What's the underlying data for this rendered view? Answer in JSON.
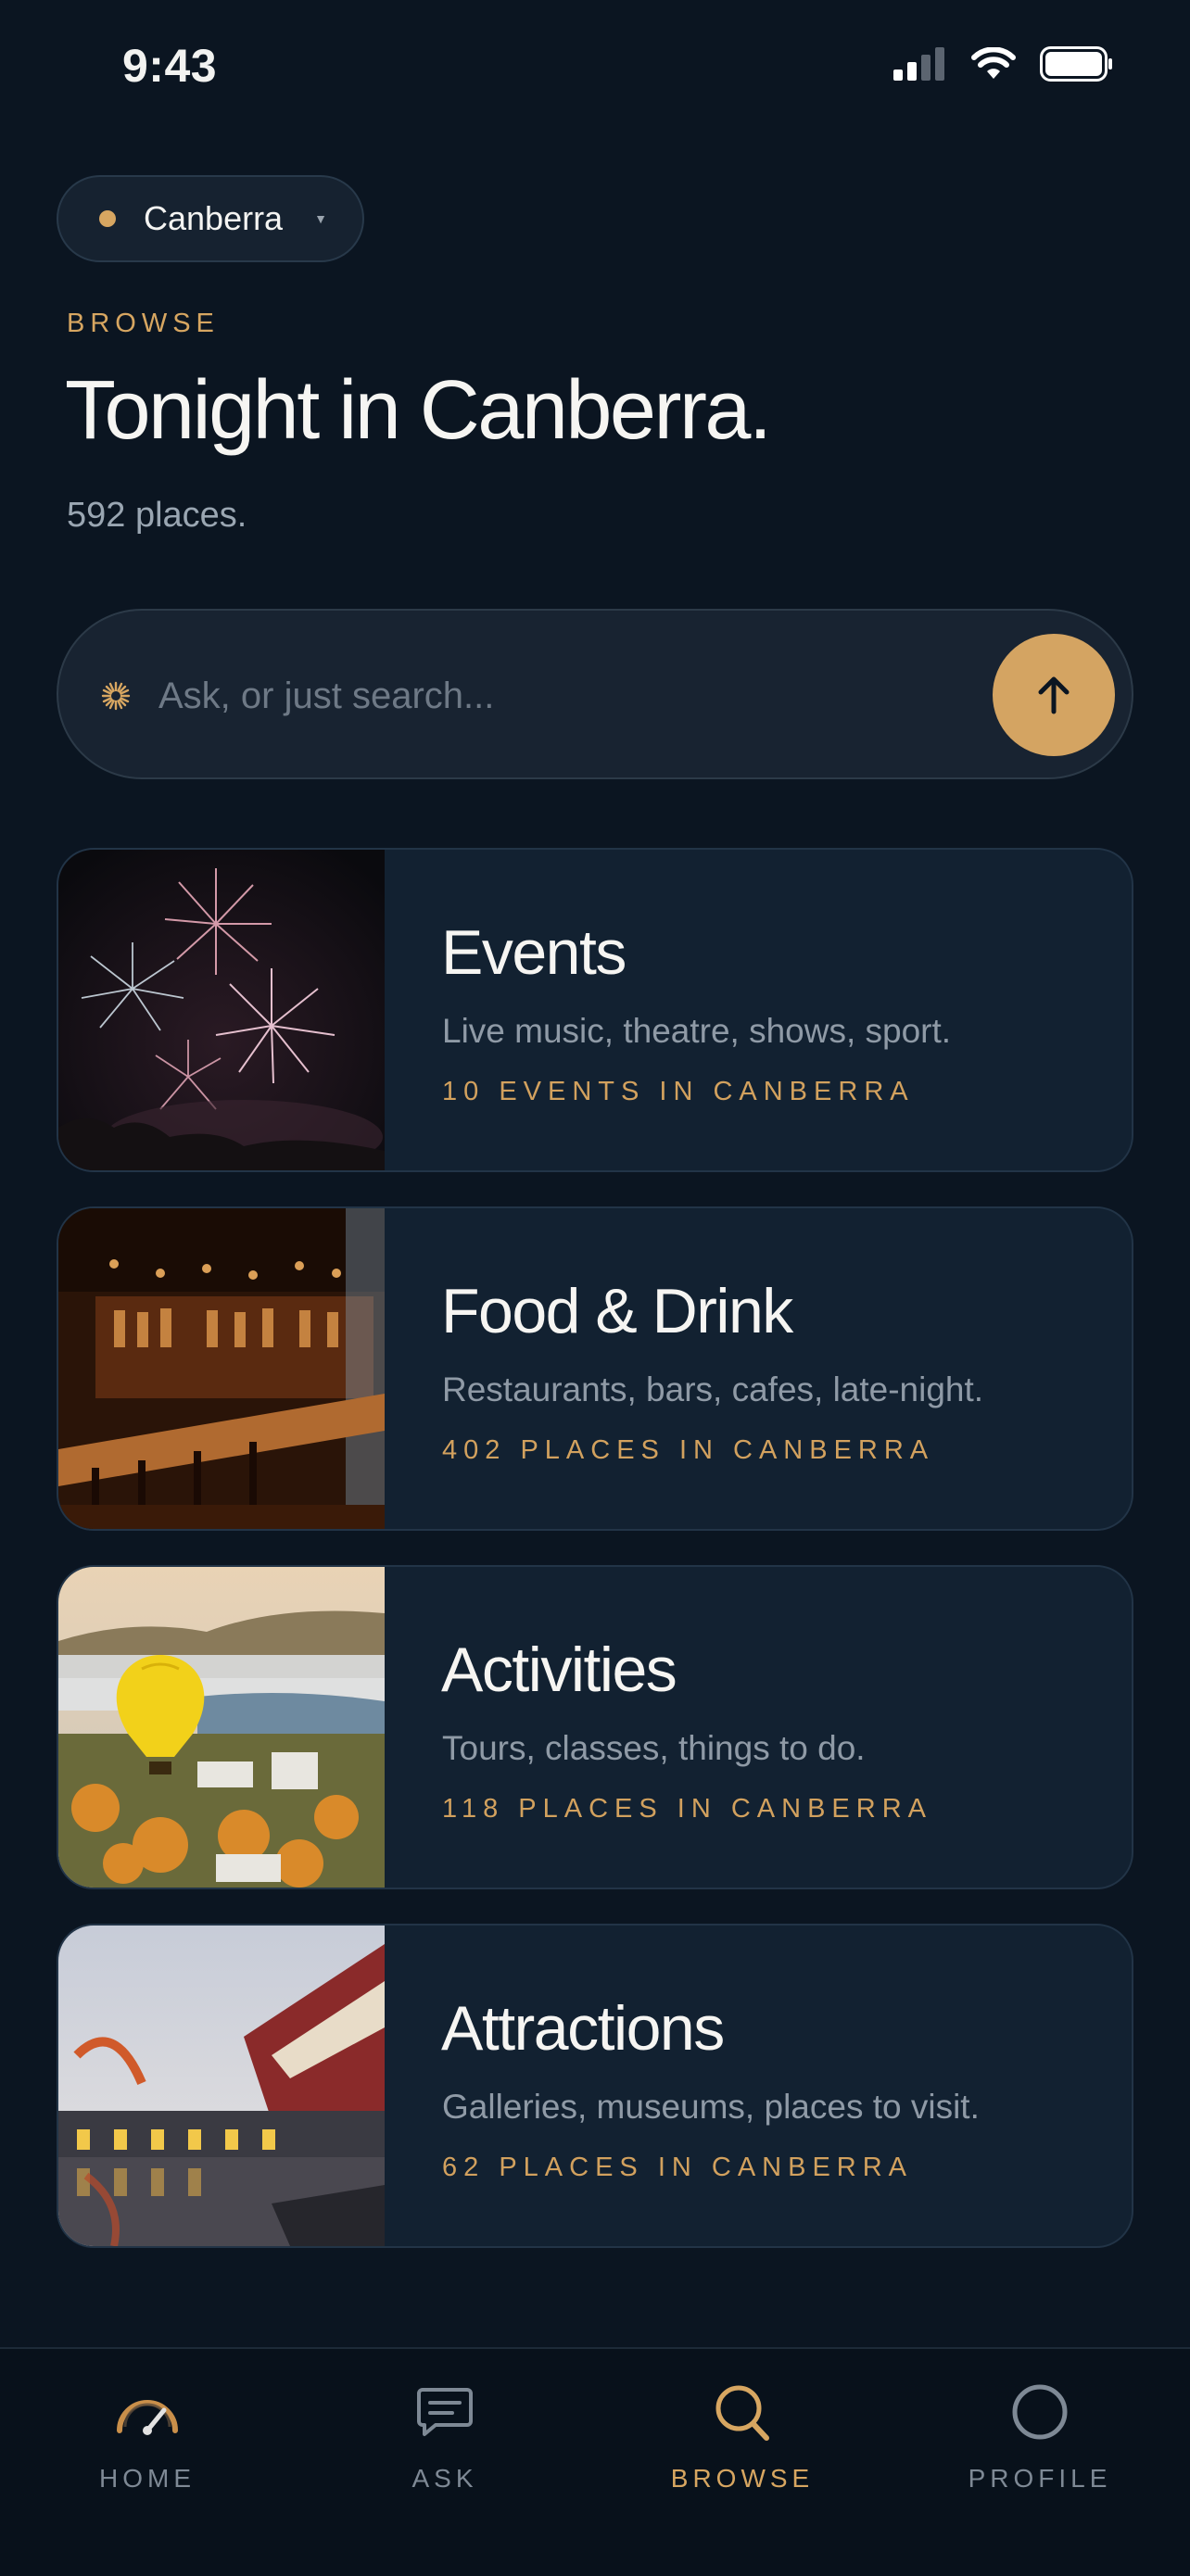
{
  "status_bar": {
    "time": "9:43"
  },
  "location": {
    "city": "Canberra"
  },
  "header": {
    "eyebrow": "BROWSE",
    "title": "Tonight in Canberra.",
    "count": "592 places."
  },
  "search": {
    "placeholder": "Ask, or just search..."
  },
  "categories": [
    {
      "title": "Events",
      "subtitle": "Live music, theatre, shows, sport.",
      "count": "10 EVENTS IN CANBERRA",
      "icon": "fireworks-photo"
    },
    {
      "title": "Food & Drink",
      "subtitle": "Restaurants, bars, cafes, late-night.",
      "count": "402 PLACES IN CANBERRA",
      "icon": "bar-interior-photo"
    },
    {
      "title": "Activities",
      "subtitle": "Tours, classes, things to do.",
      "count": "118 PLACES IN CANBERRA",
      "icon": "hot-air-balloon-photo"
    },
    {
      "title": "Attractions",
      "subtitle": "Galleries, museums, places to visit.",
      "count": "62 PLACES IN CANBERRA",
      "icon": "museum-photo"
    }
  ],
  "tab_bar": {
    "tabs": [
      {
        "label": "HOME",
        "icon": "gauge-icon"
      },
      {
        "label": "ASK",
        "icon": "chat-icon"
      },
      {
        "label": "BROWSE",
        "icon": "search-icon",
        "active": true
      },
      {
        "label": "PROFILE",
        "icon": "profile-icon"
      }
    ]
  },
  "colors": {
    "background": "#0b1521",
    "accent": "#d7a661",
    "card": "#122131"
  }
}
